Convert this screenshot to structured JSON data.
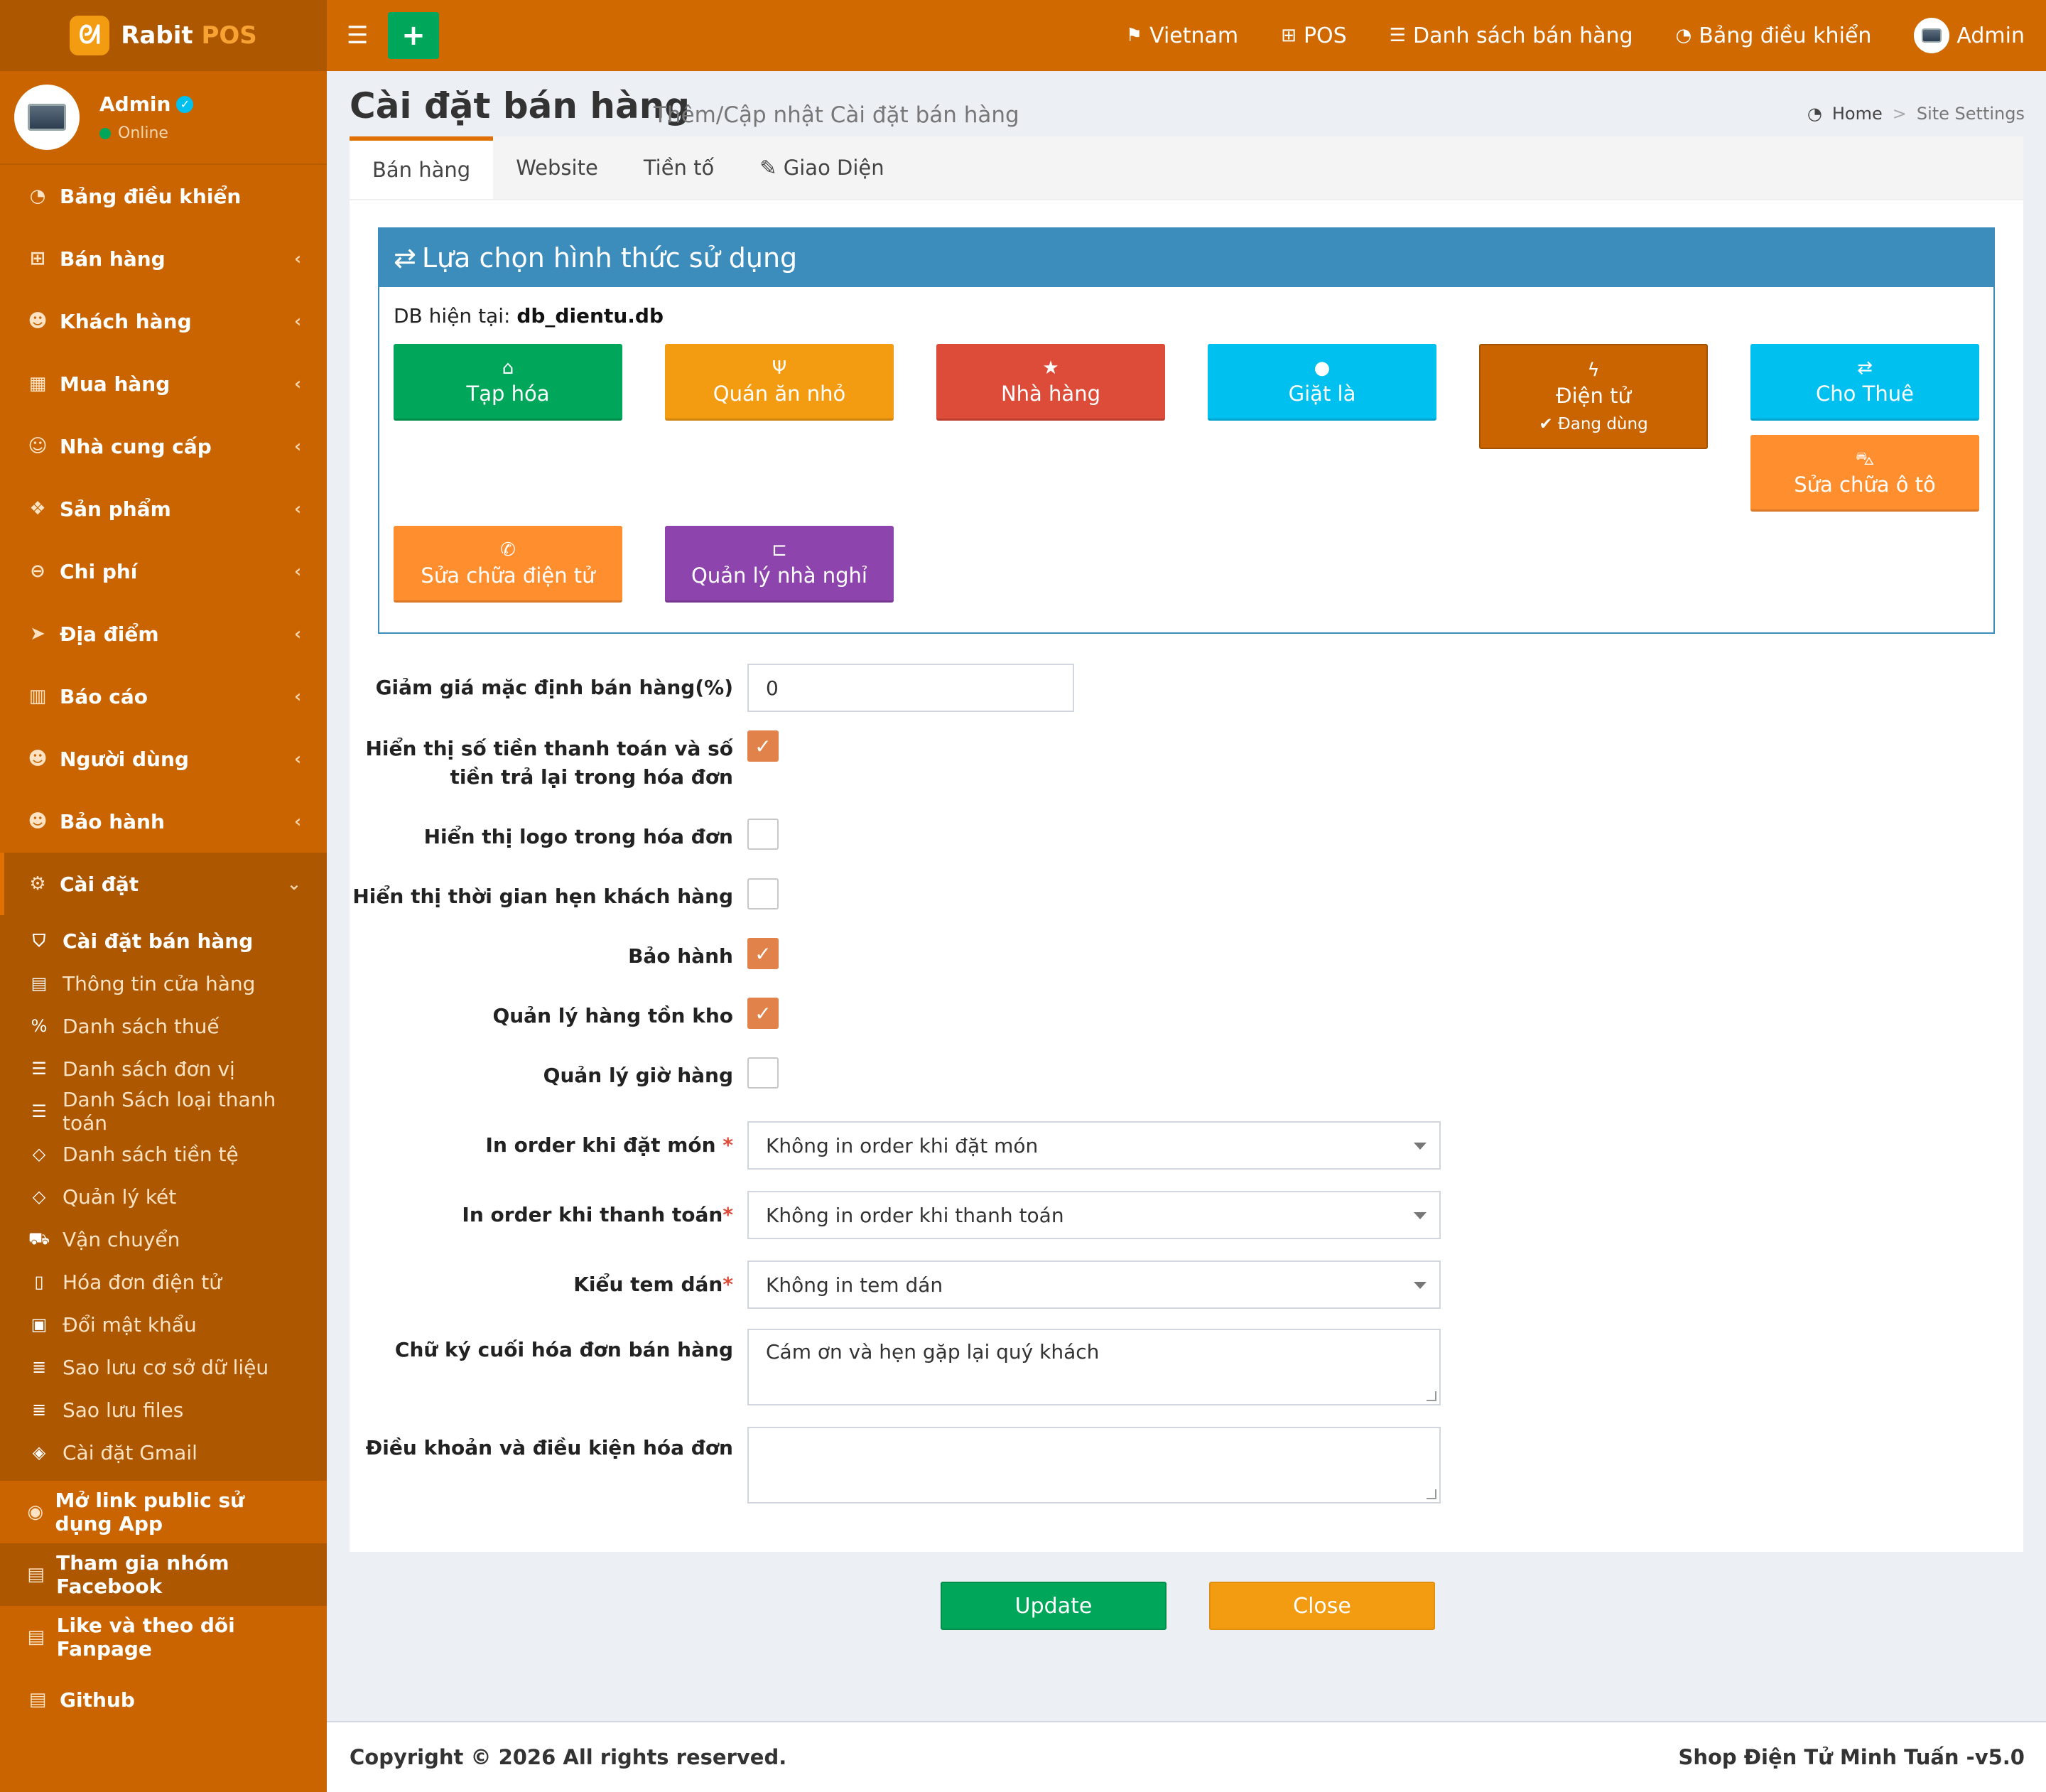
{
  "brand": {
    "name": "Rabit",
    "pos": "POS",
    "logo_icon": "rabbit-icon"
  },
  "user": {
    "name": "Admin",
    "status": "Online"
  },
  "sidebar": {
    "items": [
      {
        "label": "Bảng điều khiển",
        "icon": "dashboard-icon",
        "glyph": "◔",
        "chevron": false
      },
      {
        "label": "Bán hàng",
        "icon": "cart-icon",
        "glyph": "⊞",
        "chevron": true
      },
      {
        "label": "Khách hàng",
        "icon": "users-icon",
        "glyph": "☻",
        "chevron": true
      },
      {
        "label": "Mua hàng",
        "icon": "grid-icon",
        "glyph": "▦",
        "chevron": true
      },
      {
        "label": "Nhà cung cấp",
        "icon": "user-plus-icon",
        "glyph": "☺",
        "chevron": true
      },
      {
        "label": "Sản phẩm",
        "icon": "cubes-icon",
        "glyph": "❖",
        "chevron": true
      },
      {
        "label": "Chi phí",
        "icon": "minus-circle-icon",
        "glyph": "⊖",
        "chevron": true
      },
      {
        "label": "Địa điểm",
        "icon": "paper-plane-icon",
        "glyph": "➤",
        "chevron": true
      },
      {
        "label": "Báo cáo",
        "icon": "bar-chart-icon",
        "glyph": "▥",
        "chevron": true
      },
      {
        "label": "Người dùng",
        "icon": "users-icon",
        "glyph": "☻",
        "chevron": true
      },
      {
        "label": "Bảo hành",
        "icon": "users-icon",
        "glyph": "☻",
        "chevron": true
      }
    ],
    "settings": {
      "label": "Cài đặt",
      "children": [
        {
          "label": "Cài đặt bán hàng",
          "icon": "shield-icon",
          "glyph": "⛉"
        },
        {
          "label": "Thông tin cửa hàng",
          "icon": "briefcase-icon",
          "glyph": "▤"
        },
        {
          "label": "Danh sách thuế",
          "icon": "percent-icon",
          "glyph": "%"
        },
        {
          "label": "Danh sách đơn vị",
          "icon": "list-icon",
          "glyph": "☰"
        },
        {
          "label": "Danh Sách loại thanh toán",
          "icon": "list-icon",
          "glyph": "☰"
        },
        {
          "label": "Danh sách tiền tệ",
          "icon": "code-icon",
          "glyph": "◇"
        },
        {
          "label": "Quản lý két",
          "icon": "code-icon",
          "glyph": "◇"
        },
        {
          "label": "Vận chuyển",
          "icon": "truck-icon",
          "glyph": "⛟"
        },
        {
          "label": "Hóa đơn điện tử",
          "icon": "file-icon",
          "glyph": "▯"
        },
        {
          "label": "Đổi mật khẩu",
          "icon": "lock-icon",
          "glyph": "▣"
        },
        {
          "label": "Sao lưu cơ sở dữ liệu",
          "icon": "database-icon",
          "glyph": "≣"
        },
        {
          "label": "Sao lưu files",
          "icon": "database-icon",
          "glyph": "≣"
        },
        {
          "label": "Cài đặt Gmail",
          "icon": "cube-icon",
          "glyph": "◈"
        }
      ]
    },
    "extras": [
      {
        "label": "Mở link public sử dụng App",
        "icon": "globe-icon",
        "glyph": "◉"
      },
      {
        "label": "Tham gia nhóm Facebook",
        "icon": "briefcase-icon",
        "glyph": "▤"
      },
      {
        "label": "Like và theo dõi Fanpage",
        "icon": "briefcase-icon",
        "glyph": "▤"
      },
      {
        "label": "Github",
        "icon": "briefcase-icon",
        "glyph": "▤"
      }
    ]
  },
  "topbar": {
    "links": [
      {
        "label": "Vietnam",
        "icon": "language-icon",
        "glyph": "⚑"
      },
      {
        "label": "POS",
        "icon": "plus-square-icon",
        "glyph": "⊞"
      },
      {
        "label": "Danh sách bán hàng",
        "icon": "list-icon",
        "glyph": "☰"
      },
      {
        "label": "Bảng điều khiển",
        "icon": "dashboard-icon",
        "glyph": "◔"
      }
    ],
    "user_label": "Admin"
  },
  "page": {
    "title": "Cài đặt bán hàng",
    "subtitle": "Thêm/Cập nhật Cài đặt bán hàng",
    "breadcrumb": {
      "home": "Home",
      "sep": ">",
      "current": "Site Settings"
    }
  },
  "tabs": [
    {
      "label": "Bán hàng",
      "active": true
    },
    {
      "label": "Website",
      "active": false
    },
    {
      "label": "Tiền tố",
      "active": false
    },
    {
      "label": "Giao Diện",
      "active": false,
      "icon": "paint-brush-icon",
      "glyph": "✎"
    }
  ],
  "usage": {
    "title": "Lựa chọn hình thức sử dụng",
    "db_label": "DB hiện tại:",
    "db_name": "db_dientu.db",
    "modes": [
      {
        "label": "Tạp hóa",
        "icon": "basket-icon",
        "glyph": "⌂",
        "color": "#00a65a"
      },
      {
        "label": "Quán ăn nhỏ",
        "icon": "cutlery-icon",
        "glyph": "Ψ",
        "color": "#f39c12"
      },
      {
        "label": "Nhà hàng",
        "icon": "star-icon",
        "glyph": "★",
        "color": "#dd4b39"
      },
      {
        "label": "Giặt là",
        "icon": "tint-icon",
        "glyph": "●",
        "color": "#00c0ef"
      },
      {
        "label": "Điện tử",
        "icon": "bolt-icon",
        "glyph": "ϟ",
        "color": "#c96400",
        "note": "✔ Đang dùng"
      },
      {
        "label": "Cho Thuê",
        "icon": "exchange-icon",
        "glyph": "⇄",
        "color": "#00c0ef"
      },
      {
        "label": "Sửa chữa ô tô",
        "icon": "car-icon",
        "glyph": "⛍",
        "color": "#ff8f2e"
      },
      {
        "label": "Sửa chữa điện tử",
        "icon": "wrench-icon",
        "glyph": "✆",
        "color": "#ff8f2e"
      },
      {
        "label": "Quản lý nhà nghỉ",
        "icon": "bed-icon",
        "glyph": "⊏",
        "color": "#8e44ad"
      }
    ]
  },
  "form": {
    "discount": {
      "label": "Giảm giá mặc định bán hàng(%)",
      "value": "0"
    },
    "show_paid": {
      "label_1": "Hiển thị số tiền thanh toán và số",
      "label_2": "tiền trả lại trong hóa đơn",
      "checked": true
    },
    "show_logo": {
      "label": "Hiển thị logo trong hóa đơn",
      "checked": false
    },
    "show_time": {
      "label": "Hiển thị thời gian hẹn khách hàng",
      "checked": false
    },
    "warranty": {
      "label": "Bảo hành",
      "checked": true
    },
    "inventory": {
      "label": "Quản lý hàng tồn kho",
      "checked": true
    },
    "hours": {
      "label": "Quản lý giờ hàng",
      "checked": false
    },
    "print_order": {
      "label": "In order khi đặt món ",
      "required": "*",
      "value": "Không in order khi đặt món"
    },
    "print_pay": {
      "label": "In order khi thanh toán",
      "required": "*",
      "value": "Không in order khi thanh toán"
    },
    "sticker": {
      "label": "Kiểu tem dán",
      "required": "*",
      "value": "Không in tem dán"
    },
    "signature": {
      "label": "Chữ ký cuối hóa đơn bán hàng",
      "value": "Cám ơn và hẹn gặp lại quý khách"
    },
    "terms": {
      "label": "Điều khoản và điều kiện hóa đơn",
      "value": ""
    }
  },
  "buttons": {
    "update": "Update",
    "close": "Close"
  },
  "footer": {
    "copyright": "Copyright © 2026 All rights reserved.",
    "version": "Shop Điện Tử Minh Tuấn -v5.0"
  }
}
